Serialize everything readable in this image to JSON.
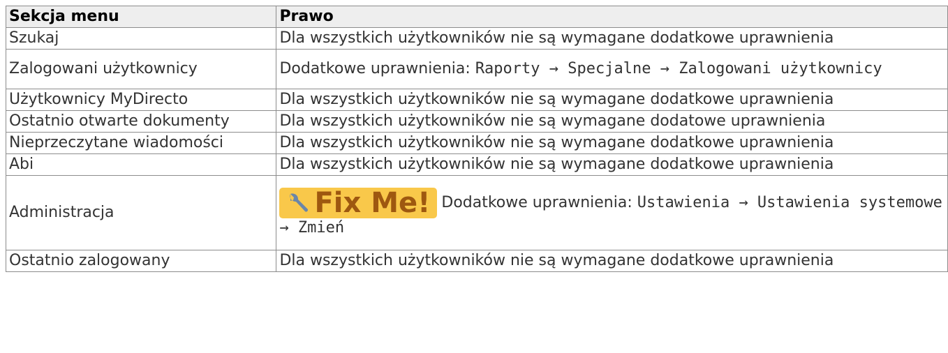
{
  "table": {
    "headers": [
      "Sekcja menu",
      "Prawo"
    ],
    "rows": [
      {
        "section": "Szukaj",
        "right": "Dla wszystkich użytkowników nie są wymagane dodatkowe uprawnienia"
      },
      {
        "section": "Zalogowani użytkownicy",
        "right_prefix": "Dodatkowe uprawnienia: ",
        "right_code": "Raporty → Specjalne → Zalogowani użytkownicy"
      },
      {
        "section": "Użytkownicy MyDirecto",
        "right": "Dla wszystkich użytkowników nie są wymagane dodatkowe uprawnienia"
      },
      {
        "section": "Ostatnio otwarte dokumenty",
        "right": "Dla wszystkich użytkowników nie są wymagane dodatowe uprawnienia"
      },
      {
        "section": "Nieprzeczytane wiadomości",
        "right": "Dla wszystkich użytkowników nie są wymagane dodatkowe uprawnienia"
      },
      {
        "section": "Abi",
        "right": "Dla wszystkich użytkowników nie są wymagane dodatkowe uprawnienia"
      },
      {
        "section": "Administracja",
        "fixme_label": "Fix Me!",
        "right_prefix": "Dodatkowe uprawnienia: ",
        "right_code": "Ustawienia → Ustawienia systemowe → Zmień"
      },
      {
        "section": "Ostatnio zalogowany",
        "right": "Dla wszystkich użytkowników nie są wymagane dodatkowe uprawnienia"
      }
    ]
  },
  "colors": {
    "fixme_bg": "#f9c84a",
    "fixme_text": "#9e5810",
    "header_bg": "#eeeeee",
    "border": "#8c8c8c"
  },
  "icons": {
    "fixme": "wrench-icon"
  }
}
